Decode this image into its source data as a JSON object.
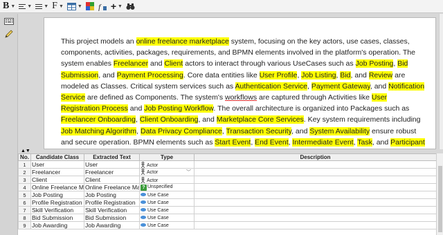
{
  "toolbar": {
    "bold_glyph": "B",
    "font_glyph": "F",
    "add_glyph": "+"
  },
  "document": {
    "segments": [
      {
        "t": "This project models an "
      },
      {
        "t": "online freelance marketplace",
        "h": true
      },
      {
        "t": " system, focusing on the key actors, use cases, classes, components, activities, packages, requirements, and BPMN elements involved in the platform's operation. The system enables "
      },
      {
        "t": "Freelancer",
        "h": true
      },
      {
        "t": " and "
      },
      {
        "t": "Client",
        "h": true
      },
      {
        "t": " actors to interact through various UseCases such as "
      },
      {
        "t": "Job Posting",
        "h": true
      },
      {
        "t": ", "
      },
      {
        "t": "Bid Submission",
        "h": true
      },
      {
        "t": ", and "
      },
      {
        "t": "Payment Processing",
        "h": true
      },
      {
        "t": ". Core data entities like "
      },
      {
        "t": "User Profile",
        "h": true
      },
      {
        "t": ", "
      },
      {
        "t": "Job Listing",
        "h": true
      },
      {
        "t": ", "
      },
      {
        "t": "Bid",
        "h": true
      },
      {
        "t": ", and "
      },
      {
        "t": "Review",
        "h": true
      },
      {
        "t": " are modeled as Classes. Critical system services such as "
      },
      {
        "t": "Authentication Service",
        "h": true
      },
      {
        "t": ", "
      },
      {
        "t": "Payment Gateway",
        "h": true
      },
      {
        "t": ", and "
      },
      {
        "t": "Notification Service",
        "h": true
      },
      {
        "t": " are defined as Components. The system's "
      },
      {
        "t": "workflows",
        "u": true
      },
      {
        "t": " are captured through Activities like "
      },
      {
        "t": "User Registration Process",
        "h": true
      },
      {
        "t": " and "
      },
      {
        "t": "Job Posting Workflow",
        "h": true
      },
      {
        "t": ". The overall architecture is organized into Packages such as "
      },
      {
        "t": "Freelancer Onboarding",
        "h": true
      },
      {
        "t": ", "
      },
      {
        "t": "Client Onboarding",
        "h": true
      },
      {
        "t": ", and "
      },
      {
        "t": "Marketplace Core Services",
        "h": true
      },
      {
        "t": ". Key system requirements including "
      },
      {
        "t": "Job Matching Algorithm",
        "h": true
      },
      {
        "t": ", "
      },
      {
        "t": "Data Privacy Compliance",
        "h": true
      },
      {
        "t": ", "
      },
      {
        "t": "Transaction Security",
        "h": true
      },
      {
        "t": ", and "
      },
      {
        "t": "System Availability",
        "h": true
      },
      {
        "t": " ensure robust and secure operation. BPMN elements such as "
      },
      {
        "t": "Start Event",
        "h": true
      },
      {
        "t": ", "
      },
      {
        "t": "End Event",
        "h": true
      },
      {
        "t": ", "
      },
      {
        "t": "Intermediate Event",
        "h": true
      },
      {
        "t": ", "
      },
      {
        "t": "Task",
        "h": true
      },
      {
        "t": ", and "
      },
      {
        "t": "Participant",
        "h": true
      },
      {
        "t": " are used to model business processes in detail."
      }
    ]
  },
  "table": {
    "columns": [
      "No.",
      "Candidate Class",
      "Extracted Text",
      "Type",
      "Description"
    ],
    "rows": [
      {
        "no": "1",
        "candidate": "User",
        "extracted": "User",
        "type": "Actor",
        "icon": "actor",
        "dropdown": false
      },
      {
        "no": "2",
        "candidate": "Freelancer",
        "extracted": "Freelancer",
        "type": "Actor",
        "icon": "actor",
        "dropdown": true
      },
      {
        "no": "3",
        "candidate": "Client",
        "extracted": "Client",
        "type": "Actor",
        "icon": "actor",
        "dropdown": false
      },
      {
        "no": "4",
        "candidate": "Online Freelance Ma",
        "extracted": "Online Freelance Mark",
        "type": "Unspecified",
        "icon": "question",
        "dropdown": false
      },
      {
        "no": "5",
        "candidate": "Job Posting",
        "extracted": "Job Posting",
        "type": "Use Case",
        "icon": "usecase",
        "dropdown": false
      },
      {
        "no": "6",
        "candidate": "Profile Registration",
        "extracted": "Profile Registration",
        "type": "Use Case",
        "icon": "usecase",
        "dropdown": false
      },
      {
        "no": "7",
        "candidate": "Skill Verification",
        "extracted": "Skill Verification",
        "type": "Use Case",
        "icon": "usecase",
        "dropdown": false
      },
      {
        "no": "8",
        "candidate": "Bid Submission",
        "extracted": "Bid Submission",
        "type": "Use Case",
        "icon": "usecase",
        "dropdown": false
      },
      {
        "no": "9",
        "candidate": "Job Awarding",
        "extracted": "Job Awarding",
        "type": "Use Case",
        "icon": "usecase",
        "dropdown": false
      }
    ]
  }
}
